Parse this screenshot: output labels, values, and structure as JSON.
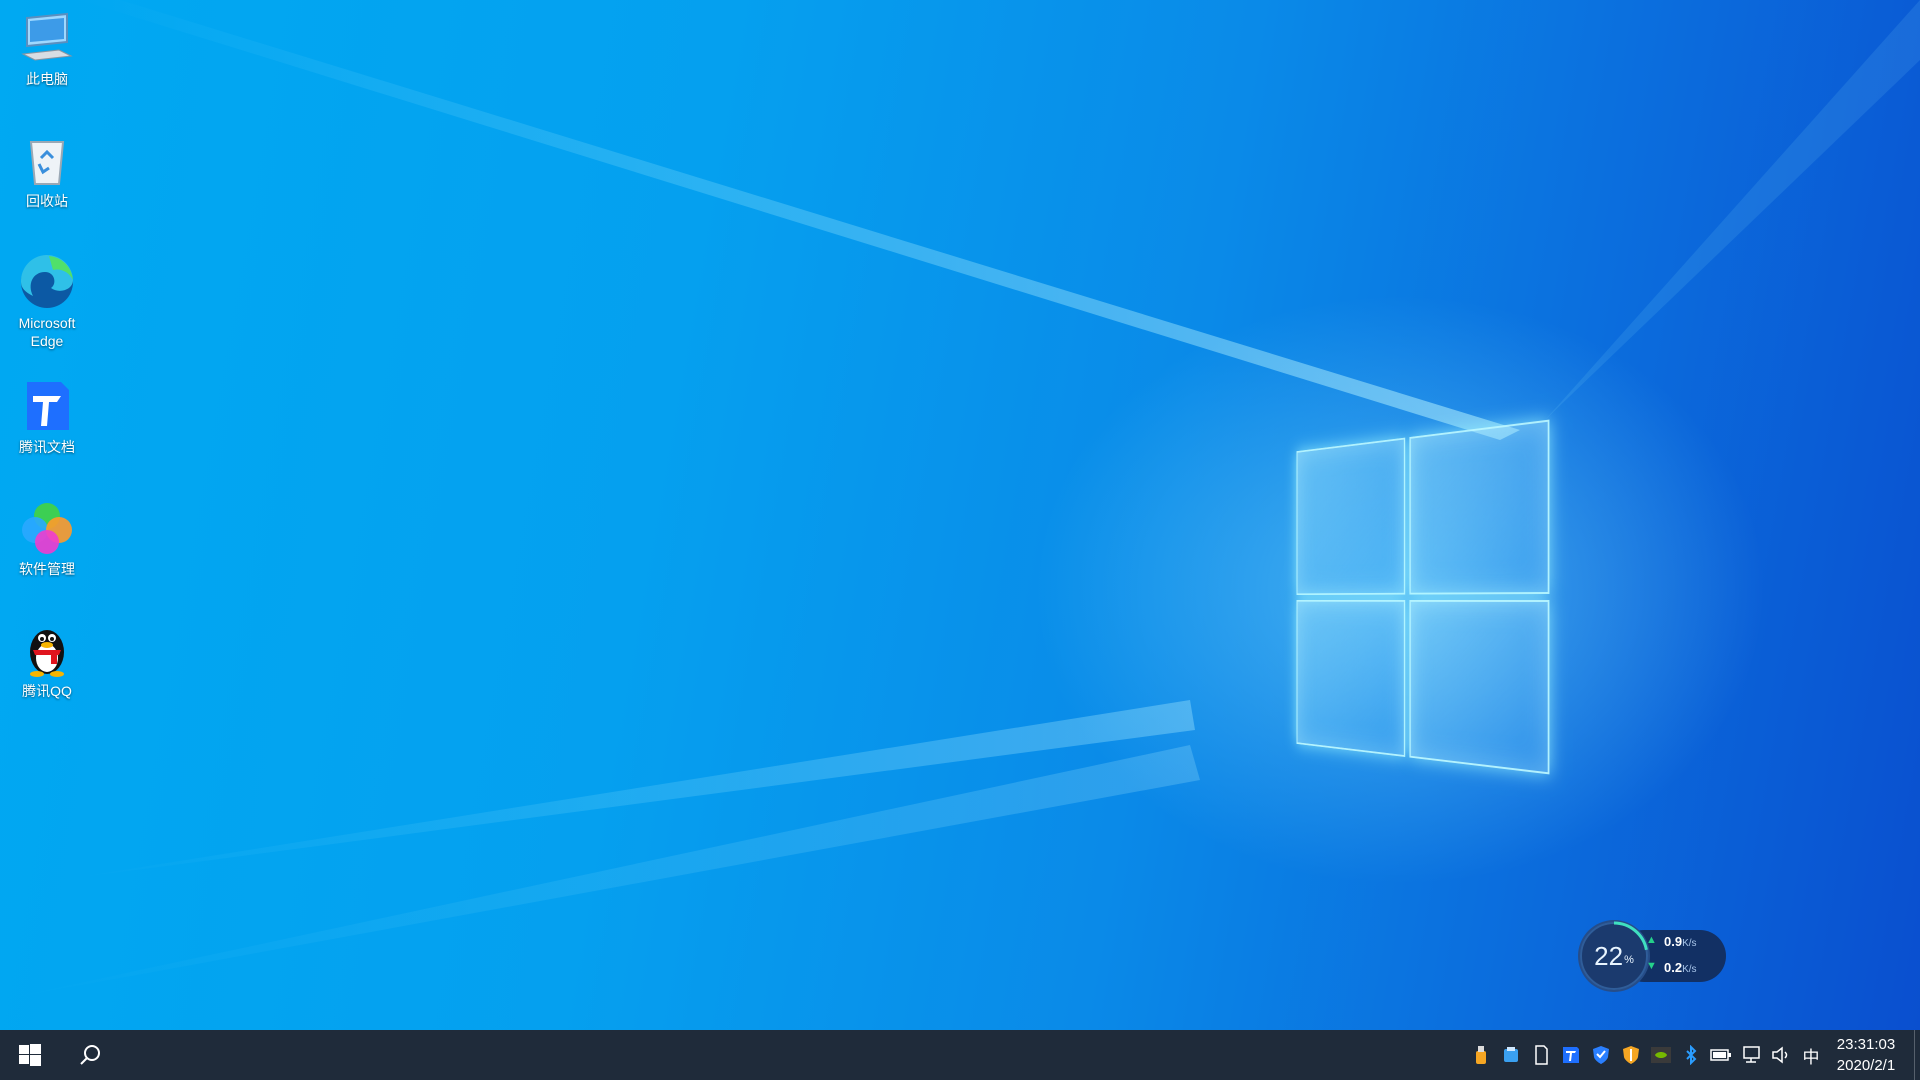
{
  "desktop": {
    "icons": [
      {
        "label": "此电脑",
        "icon": "computer-icon"
      },
      {
        "label": "回收站",
        "icon": "recycle-bin-icon"
      },
      {
        "label": "Microsoft Edge",
        "icon": "edge-icon"
      },
      {
        "label": "腾讯文档",
        "icon": "tencent-docs-icon"
      },
      {
        "label": "软件管理",
        "icon": "software-manager-icon"
      },
      {
        "label": "腾讯QQ",
        "icon": "qq-penguin-icon"
      }
    ]
  },
  "netwidget": {
    "usage": "22",
    "usage_symbol": "%",
    "usage_fraction": 0.22,
    "upload": "0.9",
    "download": "0.2",
    "unit": "K/s"
  },
  "taskbar": {
    "tray_icons": [
      "usb-drive-icon",
      "tray-app-icon",
      "sd-card-icon",
      "tencent-docs-icon",
      "shield-icon",
      "security-shield-icon",
      "nvidia-icon",
      "bluetooth-icon",
      "battery-icon",
      "network-icon",
      "volume-icon"
    ],
    "ime": "中",
    "time": "23:31:03",
    "date": "2020/2/1"
  },
  "colors": {
    "taskbar": "#1f2b3a",
    "desktop_light": "#00a9f2",
    "desktop_dark": "#0a4fcf"
  }
}
